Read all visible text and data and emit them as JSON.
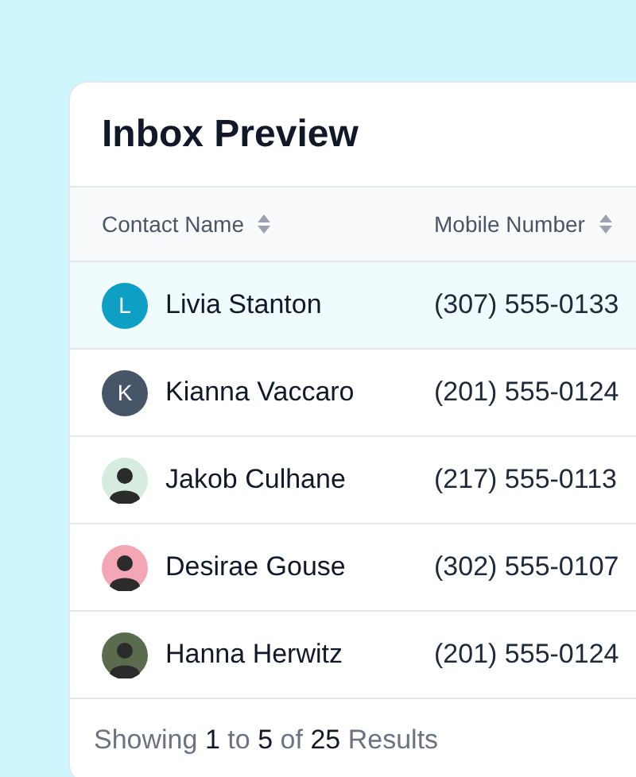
{
  "card": {
    "title": "Inbox Preview"
  },
  "table": {
    "columns": [
      "Contact Name",
      "Mobile Number"
    ],
    "rows": [
      {
        "name": "Livia Stanton",
        "phone": "(307) 555-0133",
        "selected": true,
        "avatar": {
          "kind": "initial",
          "text": "L",
          "color": "#0e9fc4"
        }
      },
      {
        "name": "Kianna Vaccaro",
        "phone": "(201) 555-0124",
        "selected": false,
        "avatar": {
          "kind": "initial",
          "text": "K",
          "color": "#475569"
        }
      },
      {
        "name": "Jakob Culhane",
        "phone": "(217) 555-0113",
        "selected": false,
        "avatar": {
          "kind": "photo",
          "color": "#d5ecdf"
        }
      },
      {
        "name": "Desirae Gouse",
        "phone": "(302) 555-0107",
        "selected": false,
        "avatar": {
          "kind": "photo",
          "color": "#f3a7b5"
        }
      },
      {
        "name": "Hanna Herwitz",
        "phone": "(201) 555-0124",
        "selected": false,
        "avatar": {
          "kind": "photo",
          "color": "#5a6b4e"
        }
      }
    ]
  },
  "footer": [
    {
      "text": "Showing",
      "emphasis": false
    },
    {
      "text": "1",
      "emphasis": true
    },
    {
      "text": "to",
      "emphasis": false
    },
    {
      "text": "5",
      "emphasis": true
    },
    {
      "text": "of",
      "emphasis": false
    },
    {
      "text": "25",
      "emphasis": true
    },
    {
      "text": "Results",
      "emphasis": false
    }
  ]
}
